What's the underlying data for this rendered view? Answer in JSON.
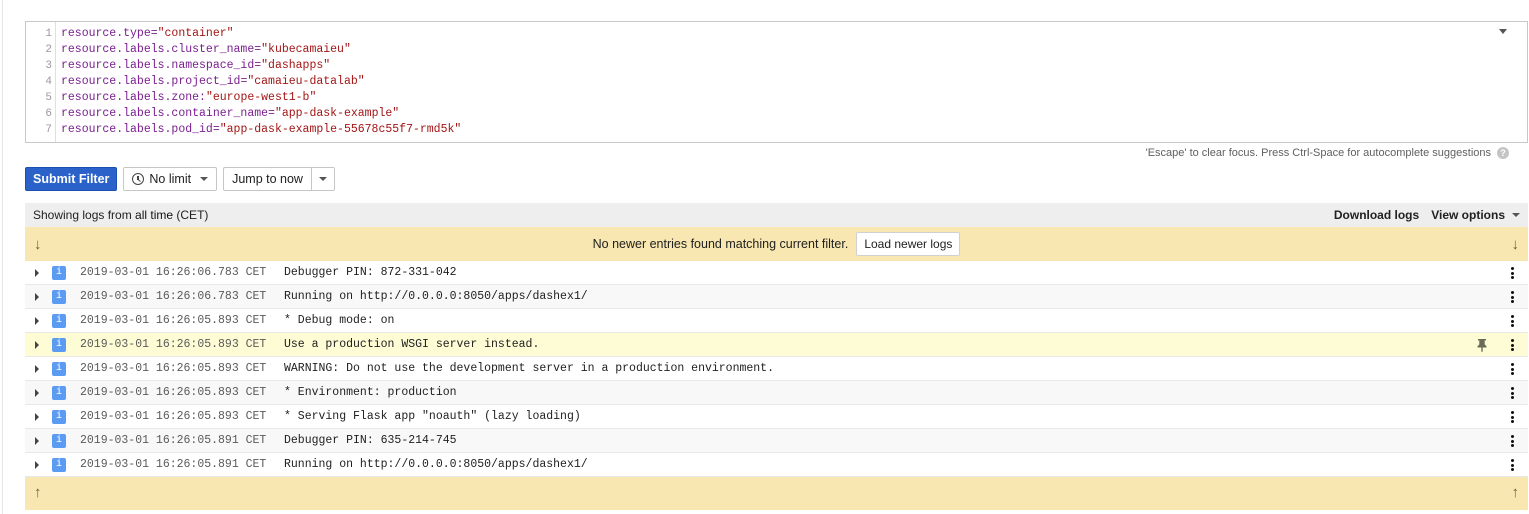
{
  "editor": {
    "lines": [
      {
        "n": "1",
        "key": "resource.type",
        "op": "=",
        "value": "\"container\""
      },
      {
        "n": "2",
        "key": "resource.labels.cluster_name",
        "op": "=",
        "value": "\"kubecamaieu\""
      },
      {
        "n": "3",
        "key": "resource.labels.namespace_id",
        "op": "=",
        "value": "\"dashapps\""
      },
      {
        "n": "4",
        "key": "resource.labels.project_id",
        "op": "=",
        "value": "\"camaieu-datalab\""
      },
      {
        "n": "5",
        "key": "resource.labels.zone",
        "op": ":",
        "value": "\"europe-west1-b\""
      },
      {
        "n": "6",
        "key": "resource.labels.container_name",
        "op": "=",
        "value": "\"app-dask-example\""
      },
      {
        "n": "7",
        "key": "resource.labels.pod_id",
        "op": "=",
        "value": "\"app-dask-example-55678c55f7-rmd5k\""
      }
    ],
    "hint": "'Escape' to clear focus. Press Ctrl-Space for autocomplete suggestions",
    "help_glyph": "?"
  },
  "toolbar": {
    "submit_label": "Submit Filter",
    "limit_label": "No limit",
    "jump_label": "Jump to now"
  },
  "logs_header": {
    "prefix": "Showing logs from ",
    "range": "all time",
    "suffix": " (CET)",
    "download_label": "Download logs",
    "view_options_label": "View options"
  },
  "top_banner": {
    "message": "No newer entries found matching current filter.",
    "load_label": "Load newer logs",
    "arrow_glyph": "↓"
  },
  "bottom_banner": {
    "arrow_glyph": "↑"
  },
  "severity_glyph": "i",
  "colors": {
    "primary": "#2a62c9",
    "banner": "#f8e7b0",
    "highlight_row": "#fdfcd5",
    "severity_info": "#5c9bf2"
  },
  "entries": [
    {
      "ts": "2019-03-01 16:26:06.783 CET",
      "msg": "Debugger PIN: 872-331-042"
    },
    {
      "ts": "2019-03-01 16:26:06.783 CET",
      "msg": "Running on http://0.0.0.0:8050/apps/dashex1/"
    },
    {
      "ts": "2019-03-01 16:26:05.893 CET",
      "msg": "* Debug mode: on"
    },
    {
      "ts": "2019-03-01 16:26:05.893 CET",
      "msg": "Use a production WSGI server instead.",
      "pinned": true
    },
    {
      "ts": "2019-03-01 16:26:05.893 CET",
      "msg": "WARNING: Do not use the development server in a production environment."
    },
    {
      "ts": "2019-03-01 16:26:05.893 CET",
      "msg": "* Environment: production"
    },
    {
      "ts": "2019-03-01 16:26:05.893 CET",
      "msg": "* Serving Flask app \"noauth\" (lazy loading)"
    },
    {
      "ts": "2019-03-01 16:26:05.891 CET",
      "msg": "Debugger PIN: 635-214-745"
    },
    {
      "ts": "2019-03-01 16:26:05.891 CET",
      "msg": "Running on http://0.0.0.0:8050/apps/dashex1/"
    }
  ]
}
